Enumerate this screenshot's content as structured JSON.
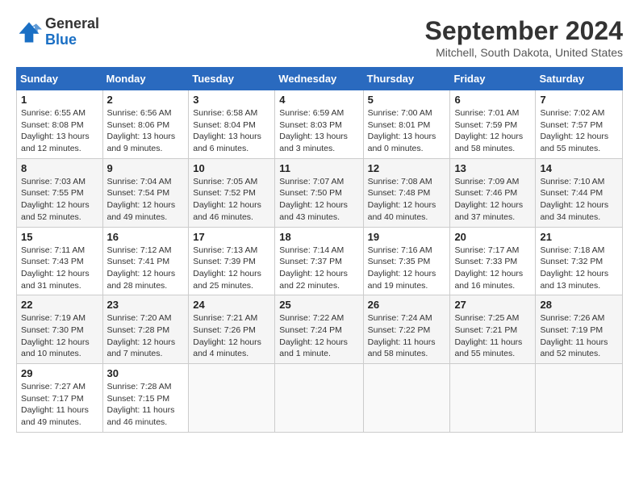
{
  "header": {
    "logo_general": "General",
    "logo_blue": "Blue",
    "month_title": "September 2024",
    "location": "Mitchell, South Dakota, United States"
  },
  "weekdays": [
    "Sunday",
    "Monday",
    "Tuesday",
    "Wednesday",
    "Thursday",
    "Friday",
    "Saturday"
  ],
  "weeks": [
    [
      {
        "day": "1",
        "sunrise": "Sunrise: 6:55 AM",
        "sunset": "Sunset: 8:08 PM",
        "daylight": "Daylight: 13 hours and 12 minutes."
      },
      {
        "day": "2",
        "sunrise": "Sunrise: 6:56 AM",
        "sunset": "Sunset: 8:06 PM",
        "daylight": "Daylight: 13 hours and 9 minutes."
      },
      {
        "day": "3",
        "sunrise": "Sunrise: 6:58 AM",
        "sunset": "Sunset: 8:04 PM",
        "daylight": "Daylight: 13 hours and 6 minutes."
      },
      {
        "day": "4",
        "sunrise": "Sunrise: 6:59 AM",
        "sunset": "Sunset: 8:03 PM",
        "daylight": "Daylight: 13 hours and 3 minutes."
      },
      {
        "day": "5",
        "sunrise": "Sunrise: 7:00 AM",
        "sunset": "Sunset: 8:01 PM",
        "daylight": "Daylight: 13 hours and 0 minutes."
      },
      {
        "day": "6",
        "sunrise": "Sunrise: 7:01 AM",
        "sunset": "Sunset: 7:59 PM",
        "daylight": "Daylight: 12 hours and 58 minutes."
      },
      {
        "day": "7",
        "sunrise": "Sunrise: 7:02 AM",
        "sunset": "Sunset: 7:57 PM",
        "daylight": "Daylight: 12 hours and 55 minutes."
      }
    ],
    [
      {
        "day": "8",
        "sunrise": "Sunrise: 7:03 AM",
        "sunset": "Sunset: 7:55 PM",
        "daylight": "Daylight: 12 hours and 52 minutes."
      },
      {
        "day": "9",
        "sunrise": "Sunrise: 7:04 AM",
        "sunset": "Sunset: 7:54 PM",
        "daylight": "Daylight: 12 hours and 49 minutes."
      },
      {
        "day": "10",
        "sunrise": "Sunrise: 7:05 AM",
        "sunset": "Sunset: 7:52 PM",
        "daylight": "Daylight: 12 hours and 46 minutes."
      },
      {
        "day": "11",
        "sunrise": "Sunrise: 7:07 AM",
        "sunset": "Sunset: 7:50 PM",
        "daylight": "Daylight: 12 hours and 43 minutes."
      },
      {
        "day": "12",
        "sunrise": "Sunrise: 7:08 AM",
        "sunset": "Sunset: 7:48 PM",
        "daylight": "Daylight: 12 hours and 40 minutes."
      },
      {
        "day": "13",
        "sunrise": "Sunrise: 7:09 AM",
        "sunset": "Sunset: 7:46 PM",
        "daylight": "Daylight: 12 hours and 37 minutes."
      },
      {
        "day": "14",
        "sunrise": "Sunrise: 7:10 AM",
        "sunset": "Sunset: 7:44 PM",
        "daylight": "Daylight: 12 hours and 34 minutes."
      }
    ],
    [
      {
        "day": "15",
        "sunrise": "Sunrise: 7:11 AM",
        "sunset": "Sunset: 7:43 PM",
        "daylight": "Daylight: 12 hours and 31 minutes."
      },
      {
        "day": "16",
        "sunrise": "Sunrise: 7:12 AM",
        "sunset": "Sunset: 7:41 PM",
        "daylight": "Daylight: 12 hours and 28 minutes."
      },
      {
        "day": "17",
        "sunrise": "Sunrise: 7:13 AM",
        "sunset": "Sunset: 7:39 PM",
        "daylight": "Daylight: 12 hours and 25 minutes."
      },
      {
        "day": "18",
        "sunrise": "Sunrise: 7:14 AM",
        "sunset": "Sunset: 7:37 PM",
        "daylight": "Daylight: 12 hours and 22 minutes."
      },
      {
        "day": "19",
        "sunrise": "Sunrise: 7:16 AM",
        "sunset": "Sunset: 7:35 PM",
        "daylight": "Daylight: 12 hours and 19 minutes."
      },
      {
        "day": "20",
        "sunrise": "Sunrise: 7:17 AM",
        "sunset": "Sunset: 7:33 PM",
        "daylight": "Daylight: 12 hours and 16 minutes."
      },
      {
        "day": "21",
        "sunrise": "Sunrise: 7:18 AM",
        "sunset": "Sunset: 7:32 PM",
        "daylight": "Daylight: 12 hours and 13 minutes."
      }
    ],
    [
      {
        "day": "22",
        "sunrise": "Sunrise: 7:19 AM",
        "sunset": "Sunset: 7:30 PM",
        "daylight": "Daylight: 12 hours and 10 minutes."
      },
      {
        "day": "23",
        "sunrise": "Sunrise: 7:20 AM",
        "sunset": "Sunset: 7:28 PM",
        "daylight": "Daylight: 12 hours and 7 minutes."
      },
      {
        "day": "24",
        "sunrise": "Sunrise: 7:21 AM",
        "sunset": "Sunset: 7:26 PM",
        "daylight": "Daylight: 12 hours and 4 minutes."
      },
      {
        "day": "25",
        "sunrise": "Sunrise: 7:22 AM",
        "sunset": "Sunset: 7:24 PM",
        "daylight": "Daylight: 12 hours and 1 minute."
      },
      {
        "day": "26",
        "sunrise": "Sunrise: 7:24 AM",
        "sunset": "Sunset: 7:22 PM",
        "daylight": "Daylight: 11 hours and 58 minutes."
      },
      {
        "day": "27",
        "sunrise": "Sunrise: 7:25 AM",
        "sunset": "Sunset: 7:21 PM",
        "daylight": "Daylight: 11 hours and 55 minutes."
      },
      {
        "day": "28",
        "sunrise": "Sunrise: 7:26 AM",
        "sunset": "Sunset: 7:19 PM",
        "daylight": "Daylight: 11 hours and 52 minutes."
      }
    ],
    [
      {
        "day": "29",
        "sunrise": "Sunrise: 7:27 AM",
        "sunset": "Sunset: 7:17 PM",
        "daylight": "Daylight: 11 hours and 49 minutes."
      },
      {
        "day": "30",
        "sunrise": "Sunrise: 7:28 AM",
        "sunset": "Sunset: 7:15 PM",
        "daylight": "Daylight: 11 hours and 46 minutes."
      },
      null,
      null,
      null,
      null,
      null
    ]
  ]
}
